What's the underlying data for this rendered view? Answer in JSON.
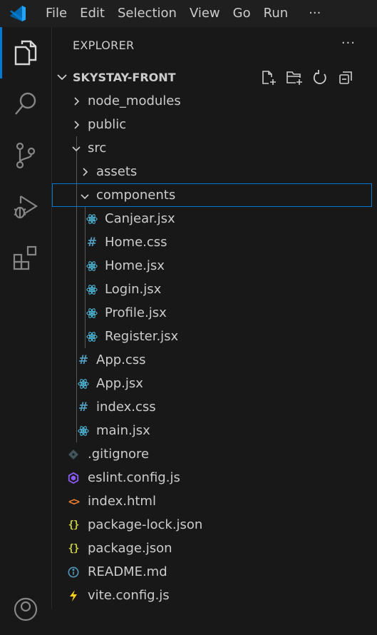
{
  "menu": {
    "items": [
      "File",
      "Edit",
      "Selection",
      "View",
      "Go",
      "Run"
    ],
    "more": "···"
  },
  "sidebar": {
    "header": "EXPLORER",
    "more": "···",
    "project_name": "SKYSTAY-FRONT"
  },
  "tree": {
    "node_modules": "node_modules",
    "public": "public",
    "src": "src",
    "assets": "assets",
    "components": "components",
    "canjear": "Canjear.jsx",
    "home_css": "Home.css",
    "home_jsx": "Home.jsx",
    "login": "Login.jsx",
    "profile": "Profile.jsx",
    "register": "Register.jsx",
    "app_css": "App.css",
    "app_jsx": "App.jsx",
    "index_css": "index.css",
    "main_jsx": "main.jsx",
    "gitignore": ".gitignore",
    "eslint": "eslint.config.js",
    "index_html": "index.html",
    "package_lock": "package-lock.json",
    "package_json": "package.json",
    "readme": "README.md",
    "vite": "vite.config.js"
  },
  "colors": {
    "accent": "#0078d4",
    "react": "#4fb8d8",
    "css": "#519aba",
    "json": "#cbcb41",
    "html": "#e37933",
    "eslint": "#8b5cf6",
    "vite": "#ffd21e"
  }
}
